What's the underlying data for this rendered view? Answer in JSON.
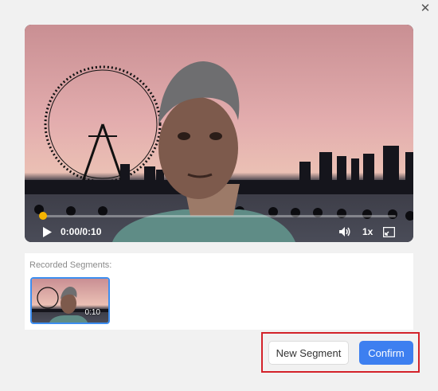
{
  "dialog": {
    "close_icon": "close-icon"
  },
  "player": {
    "current_time": "0:00",
    "duration": "0:10",
    "time_display": "0:00/0:10",
    "speed_label": "1x",
    "progress": 0,
    "progress_color": "#f5b400",
    "icons": [
      "play-icon",
      "volume-icon",
      "fullscreen-icon"
    ]
  },
  "segments": {
    "title": "Recorded Segments:",
    "items": [
      {
        "duration_label": "0:10"
      }
    ],
    "selected_border_color": "#3d8ef0"
  },
  "actions": {
    "new_segment_label": "New Segment",
    "confirm_label": "Confirm",
    "confirm_color": "#3d7ff0",
    "highlight_color": "#d3222a"
  }
}
